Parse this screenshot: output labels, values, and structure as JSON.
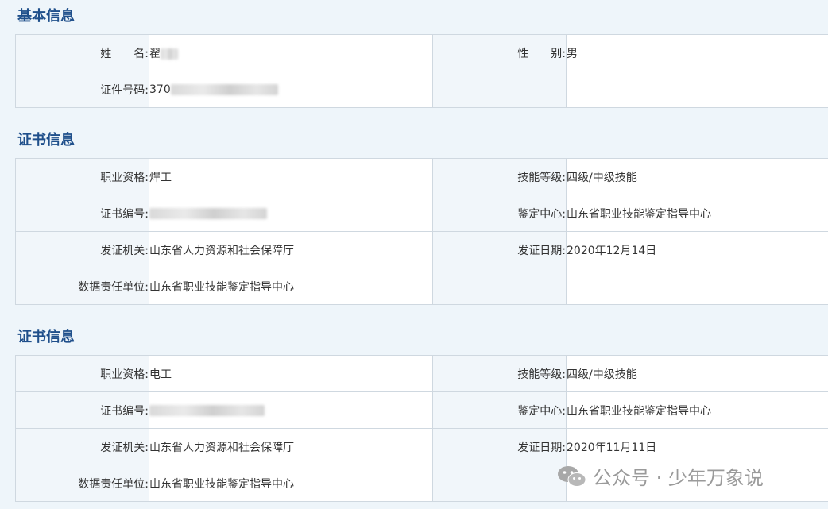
{
  "basic": {
    "title": "基本信息",
    "name_label": "姓　　名:",
    "name_value": "翟",
    "gender_label": "性　　别:",
    "gender_value": "男",
    "id_label": "证件号码:",
    "id_value": "370"
  },
  "cert1": {
    "title": "证书信息",
    "qual_label": "职业资格:",
    "qual_value": "焊工",
    "level_label": "技能等级:",
    "level_value": "四级/中级技能",
    "no_label": "证书编号:",
    "no_value": "",
    "center_label": "鉴定中心:",
    "center_value": "山东省职业技能鉴定指导中心",
    "issuer_label": "发证机关:",
    "issuer_value": "山东省人力资源和社会保障厅",
    "date_label": "发证日期:",
    "date_value": "2020年12月14日",
    "resp_label": "数据责任单位:",
    "resp_value": "山东省职业技能鉴定指导中心"
  },
  "cert2": {
    "title": "证书信息",
    "qual_label": "职业资格:",
    "qual_value": "电工",
    "level_label": "技能等级:",
    "level_value": "四级/中级技能",
    "no_label": "证书编号:",
    "no_value": "",
    "center_label": "鉴定中心:",
    "center_value": "山东省职业技能鉴定指导中心",
    "issuer_label": "发证机关:",
    "issuer_value": "山东省人力资源和社会保障厅",
    "date_label": "发证日期:",
    "date_value": "2020年11月11日",
    "resp_label": "数据责任单位:",
    "resp_value": "山东省职业技能鉴定指导中心"
  },
  "watermark": {
    "text": "公众号 · 少年万象说",
    "icon": "wechat-icon"
  }
}
